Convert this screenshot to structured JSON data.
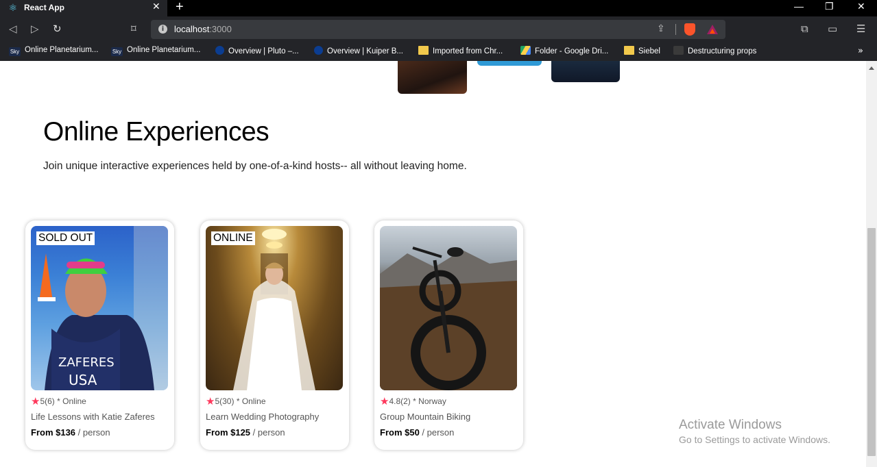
{
  "browser": {
    "tab_title": "React App",
    "url_host": "localhost",
    "url_port": ":3000",
    "window_controls": {
      "minimize": "—",
      "restore": "❐",
      "close": "✕"
    },
    "bookmarks": [
      {
        "label": "Online Planetarium...",
        "icon": "sky-icon"
      },
      {
        "label": "Online Planetarium...",
        "icon": "sky-icon"
      },
      {
        "label": "Overview | Pluto –...",
        "icon": "nasa-icon"
      },
      {
        "label": "Overview | Kuiper B...",
        "icon": "nasa-icon"
      },
      {
        "label": "Imported from Chr...",
        "icon": "folder-icon"
      },
      {
        "label": "Folder - Google Dri...",
        "icon": "google-drive-icon"
      },
      {
        "label": "Siebel",
        "icon": "folder-icon"
      },
      {
        "label": "Destructuring props",
        "icon": "react-icon"
      }
    ],
    "bookmarks_more": "»"
  },
  "page": {
    "title": "Online Experiences",
    "subtitle": "Join unique interactive experiences held by one-of-a-kind hosts-- all without leaving home.",
    "cards": [
      {
        "badge": "SOLD OUT",
        "rating": "5",
        "review_count": "(6)",
        "location": " * Online",
        "title": "Life Lessons with Katie Zaferes",
        "price": "From $136",
        "unit": " / person",
        "jersey_line1": "ZAFERES",
        "jersey_line2": "USA"
      },
      {
        "badge": "ONLINE",
        "rating": "5",
        "review_count": "(30)",
        "location": " * Online",
        "title": "Learn Wedding Photography",
        "price": "From $125",
        "unit": " / person"
      },
      {
        "badge": "",
        "rating": "4.8",
        "review_count": "(2)",
        "location": " * Norway",
        "title": "Group Mountain Biking",
        "price": "From $50",
        "unit": " / person"
      }
    ]
  },
  "watermark": {
    "line1": "Activate Windows",
    "line2": "Go to Settings to activate Windows."
  },
  "colors": {
    "star": "#fe385c",
    "chrome_bg": "#232428",
    "accent_brave": "#fb542b"
  }
}
